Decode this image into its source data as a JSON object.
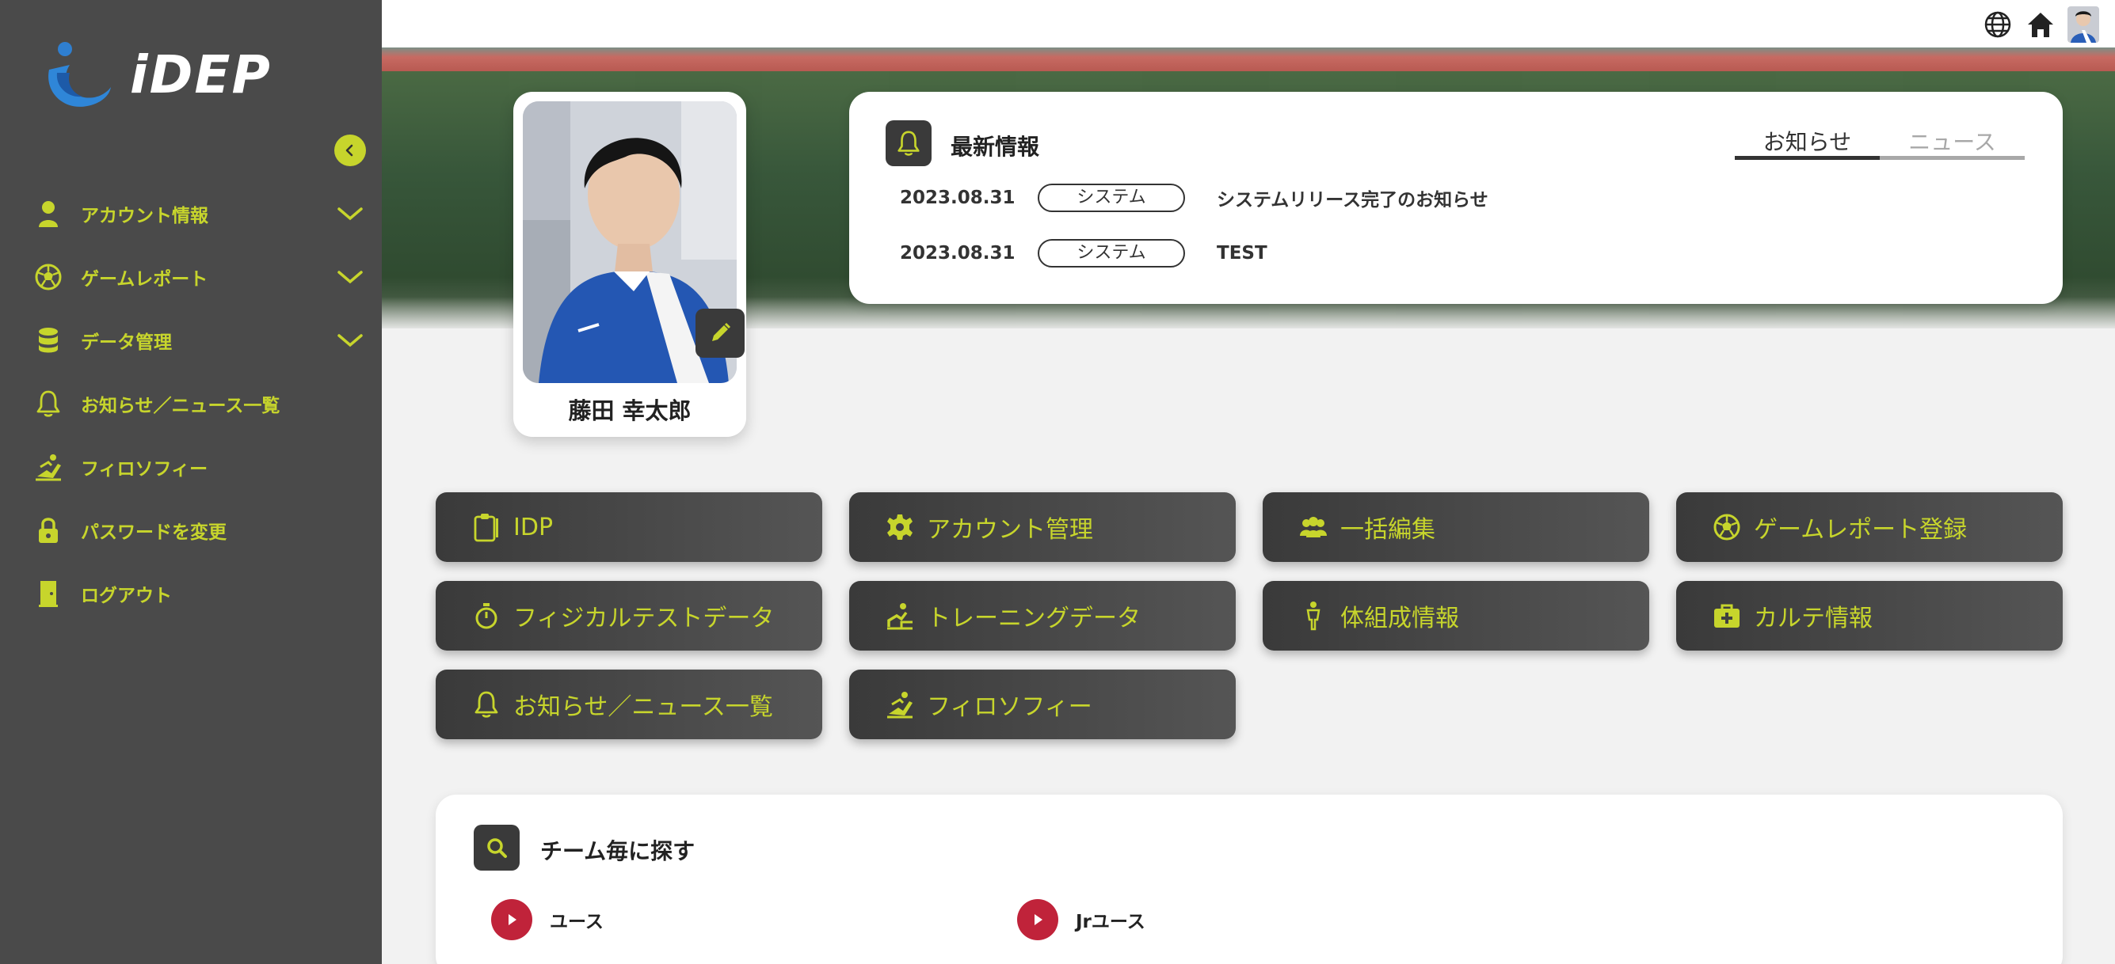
{
  "app": {
    "logo_text": "iDEP"
  },
  "sidebar": {
    "items": [
      {
        "label": "アカウント情報",
        "icon": "user-icon",
        "expandable": true
      },
      {
        "label": "ゲームレポート",
        "icon": "soccer-ball-icon",
        "expandable": true
      },
      {
        "label": "データ管理",
        "icon": "database-icon",
        "expandable": true
      },
      {
        "label": "お知らせ／ニュース一覧",
        "icon": "bell-icon",
        "expandable": false
      },
      {
        "label": "フィロソフィー",
        "icon": "philosophy-icon",
        "expandable": false
      },
      {
        "label": "パスワードを変更",
        "icon": "lock-icon",
        "expandable": false
      },
      {
        "label": "ログアウト",
        "icon": "logout-icon",
        "expandable": false
      }
    ]
  },
  "topbar": {
    "icons": [
      "globe-icon",
      "home-icon",
      "avatar"
    ]
  },
  "profile": {
    "name": "藤田 幸太郎"
  },
  "news": {
    "title": "最新情報",
    "tabs": [
      {
        "label": "お知らせ",
        "active": true
      },
      {
        "label": "ニュース",
        "active": false
      }
    ],
    "rows": [
      {
        "date": "2023.08.31",
        "category": "システム",
        "text": "システムリリース完了のお知らせ"
      },
      {
        "date": "2023.08.31",
        "category": "システム",
        "text": "TEST"
      }
    ]
  },
  "menu": [
    {
      "label": "IDP",
      "icon": "clipboard-icon"
    },
    {
      "label": "アカウント管理",
      "icon": "gear-icon"
    },
    {
      "label": "一括編集",
      "icon": "group-icon"
    },
    {
      "label": "ゲームレポート登録",
      "icon": "soccer-ball-icon"
    },
    {
      "label": "フィジカルテストデータ",
      "icon": "stopwatch-icon"
    },
    {
      "label": "トレーニングデータ",
      "icon": "training-icon"
    },
    {
      "label": "体組成情報",
      "icon": "body-icon"
    },
    {
      "label": "カルテ情報",
      "icon": "medical-kit-icon"
    },
    {
      "label": "お知らせ／ニュース一覧",
      "icon": "bell-icon"
    },
    {
      "label": "フィロソフィー",
      "icon": "philosophy-icon"
    }
  ],
  "team_search": {
    "title": "チーム毎に探す",
    "teams": [
      {
        "label": "ユース"
      },
      {
        "label": "Jrユース"
      }
    ]
  },
  "colors": {
    "accent": "#c7d52c",
    "sidebar_bg": "#4a4a4a",
    "button_dark": "#3a3a3a",
    "team_red": "#c0233a"
  }
}
